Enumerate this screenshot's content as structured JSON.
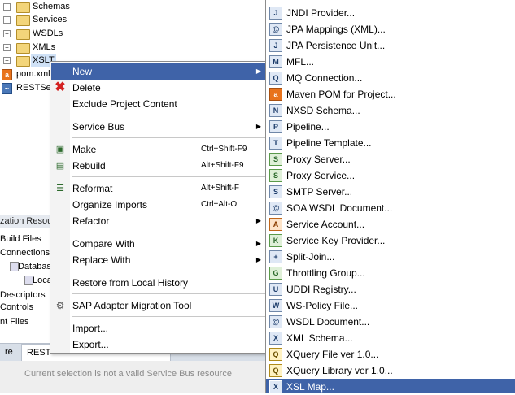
{
  "tree": {
    "items": [
      {
        "label": "Schemas",
        "kind": "folder"
      },
      {
        "label": "Services",
        "kind": "folder"
      },
      {
        "label": "WSDLs",
        "kind": "folder"
      },
      {
        "label": "XMLs",
        "kind": "folder"
      },
      {
        "label": "XSLT",
        "kind": "folder"
      },
      {
        "label": "pom.xml",
        "kind": "file"
      },
      {
        "label": "RESTSer",
        "kind": "service"
      }
    ],
    "expand_glyph": "+"
  },
  "left_panel": {
    "rows": [
      "zation Resour",
      "Build Files",
      "Connections",
      "Databas",
      "Local",
      "Descriptors",
      "Controls",
      "nt Files"
    ]
  },
  "bottom": {
    "tab1": "re",
    "tab2": "REST",
    "status": "Current selection is not a valid Service Bus resource"
  },
  "context_menu": {
    "new": {
      "label": "New",
      "icon": "none"
    },
    "delete": {
      "label": "Delete",
      "icon": "red-x-icon"
    },
    "exclude": {
      "label": "Exclude Project Content"
    },
    "service_bus": {
      "label": "Service Bus"
    },
    "make": {
      "label": "Make",
      "shortcut": "Ctrl+Shift-F9"
    },
    "rebuild": {
      "label": "Rebuild",
      "shortcut": "Alt+Shift-F9"
    },
    "reformat": {
      "label": "Reformat",
      "shortcut": "Alt+Shift-F"
    },
    "organize_imports": {
      "label": "Organize Imports",
      "shortcut": "Ctrl+Alt-O"
    },
    "refactor": {
      "label": "Refactor"
    },
    "compare_with": {
      "label": "Compare With"
    },
    "replace_with": {
      "label": "Replace With"
    },
    "restore_history": {
      "label": "Restore from Local History"
    },
    "sap_tool": {
      "label": "SAP Adapter Migration Tool"
    },
    "import": {
      "label": "Import..."
    },
    "export": {
      "label": "Export..."
    },
    "submenu_arrow": "▶"
  },
  "submenu": {
    "items": [
      {
        "label": "JNDI Provider...",
        "icon": "J"
      },
      {
        "label": "JPA Mappings (XML)...",
        "icon": "@"
      },
      {
        "label": "JPA Persistence Unit...",
        "icon": "J"
      },
      {
        "label": "MFL...",
        "icon": "M"
      },
      {
        "label": "MQ Connection...",
        "icon": "Q"
      },
      {
        "label": "Maven POM for Project...",
        "icon": "a"
      },
      {
        "label": "NXSD Schema...",
        "icon": "N"
      },
      {
        "label": "Pipeline...",
        "icon": "P"
      },
      {
        "label": "Pipeline Template...",
        "icon": "T"
      },
      {
        "label": "Proxy Server...",
        "icon": "S"
      },
      {
        "label": "Proxy Service...",
        "icon": "S"
      },
      {
        "label": "SMTP Server...",
        "icon": "S"
      },
      {
        "label": "SOA WSDL Document...",
        "icon": "@"
      },
      {
        "label": "Service Account...",
        "icon": "A"
      },
      {
        "label": "Service Key Provider...",
        "icon": "K"
      },
      {
        "label": "Split-Join...",
        "icon": "+"
      },
      {
        "label": "Throttling Group...",
        "icon": "G"
      },
      {
        "label": "UDDI Registry...",
        "icon": "U"
      },
      {
        "label": "WS-Policy File...",
        "icon": "W"
      },
      {
        "label": "WSDL Document...",
        "icon": "@"
      },
      {
        "label": "XML Schema...",
        "icon": "X"
      },
      {
        "label": "XQuery File ver 1.0...",
        "icon": "Q"
      },
      {
        "label": "XQuery Library ver 1.0...",
        "icon": "Q"
      },
      {
        "label": "XSL Map...",
        "icon": "X"
      }
    ]
  },
  "colors": {
    "highlight": "#3f63a8",
    "menu_border": "#8c8c8c",
    "delete_icon": "#d32020"
  }
}
